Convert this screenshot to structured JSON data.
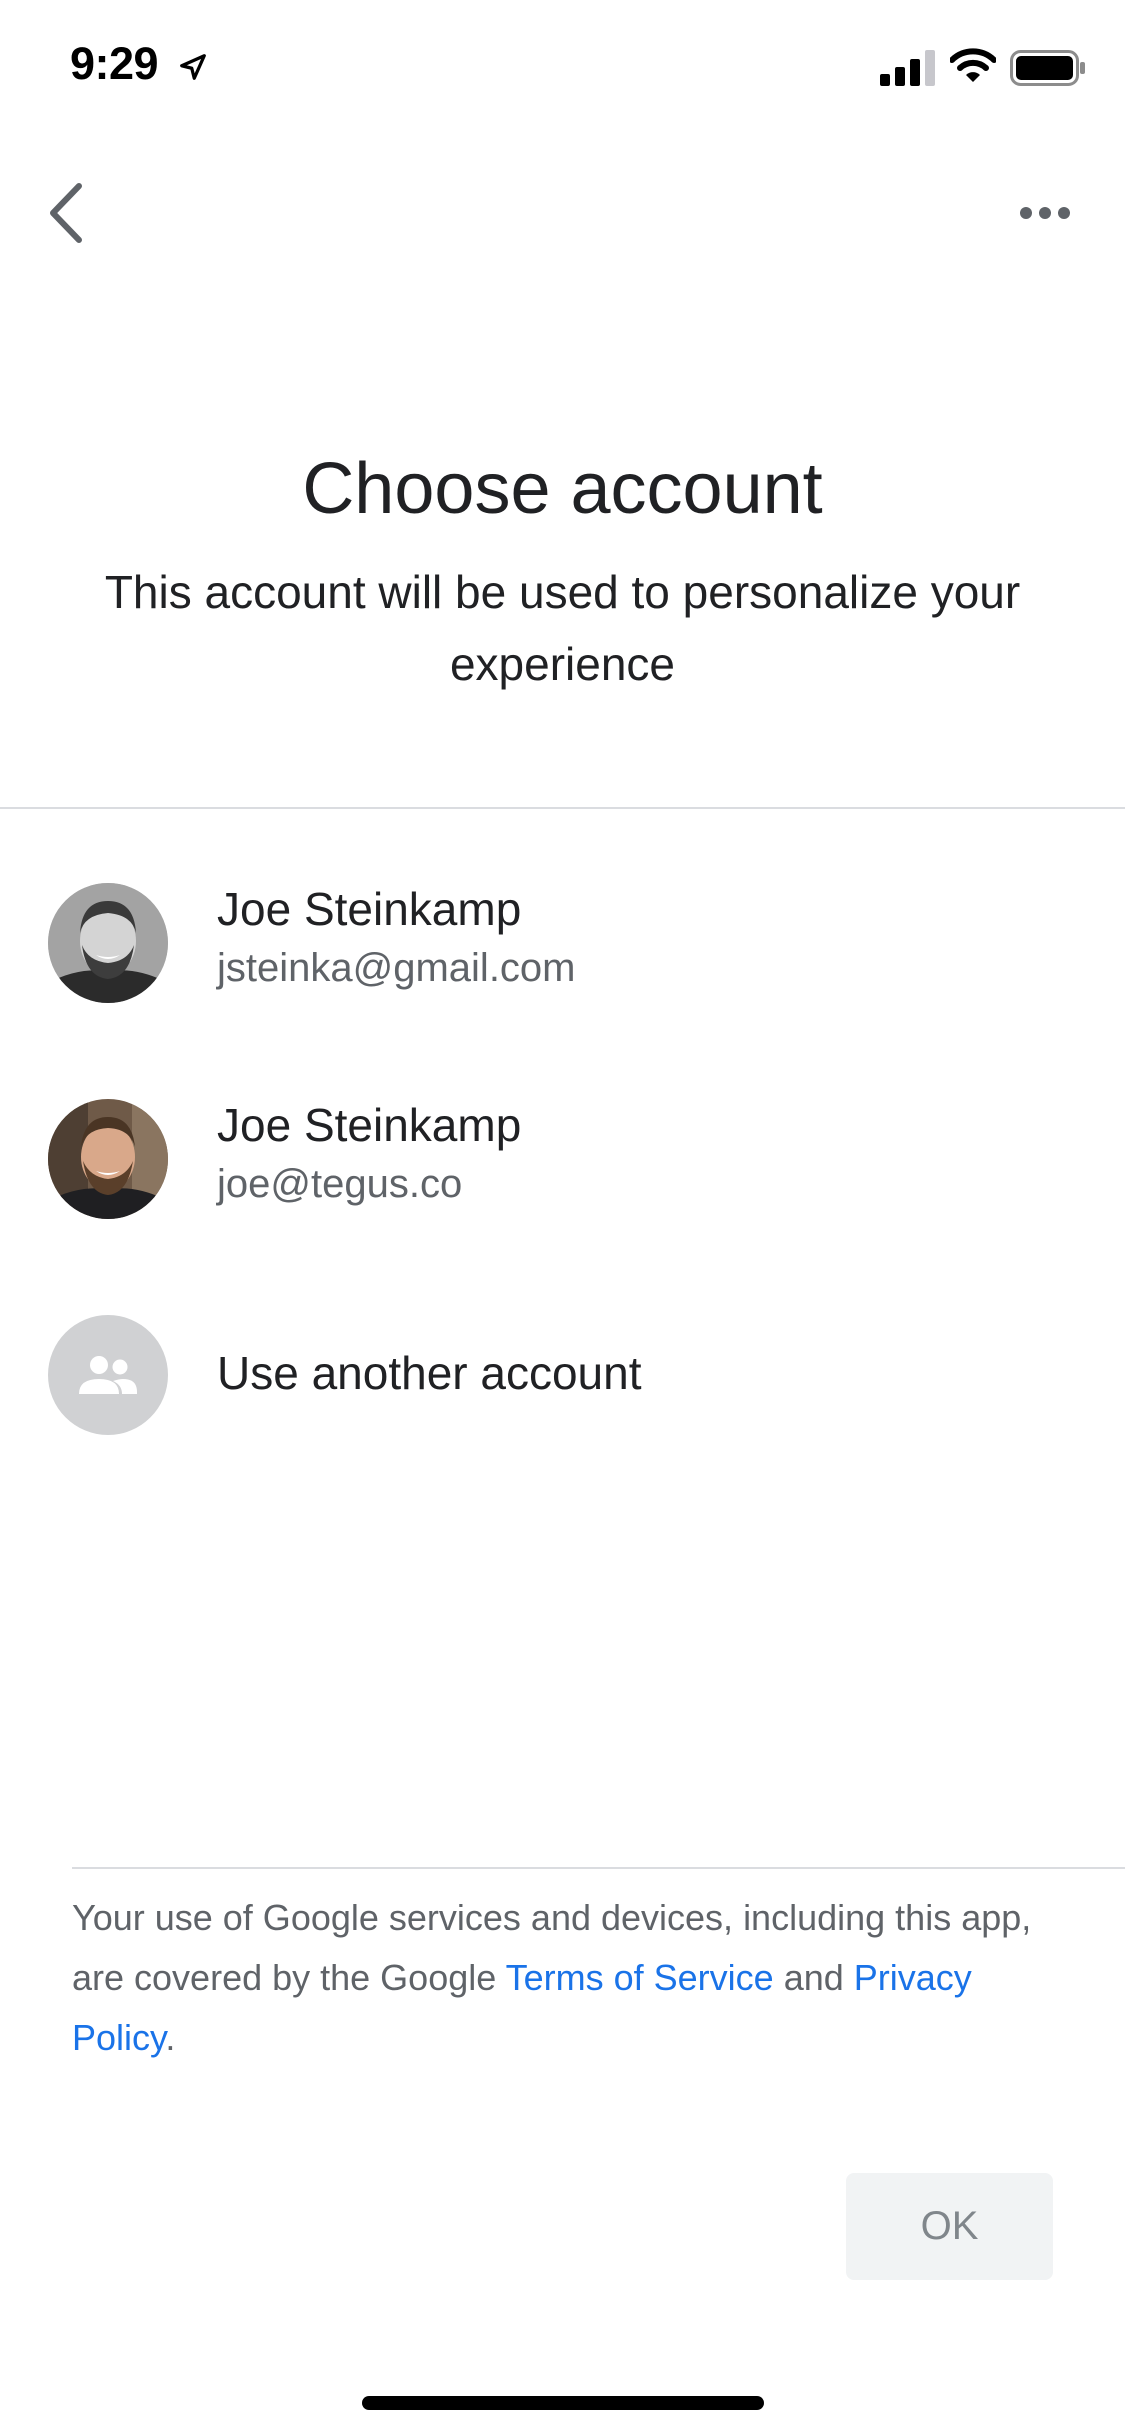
{
  "status_bar": {
    "time": "9:29",
    "icons": [
      "location-arrow-icon",
      "cellular-signal-icon",
      "wifi-icon",
      "battery-icon"
    ]
  },
  "nav": {
    "back_icon": "chevron-left-icon",
    "more_icon": "more-horizontal-icon"
  },
  "header": {
    "title": "Choose account",
    "subtitle": "This account will be used to personalize your experience"
  },
  "accounts": [
    {
      "name": "Joe Steinkamp",
      "email": "jsteinka@gmail.com"
    },
    {
      "name": "Joe Steinkamp",
      "email": "joe@tegus.co"
    }
  ],
  "other_account": {
    "label": "Use another account",
    "icon": "people-icon"
  },
  "footer": {
    "legal_prefix": "Your use of Google services and devices, including this app, are covered by the Google ",
    "terms_link": "Terms of Service",
    "legal_and": " and ",
    "privacy_link": "Privacy Policy",
    "legal_suffix": "."
  },
  "ok_button": {
    "label": "OK"
  },
  "colors": {
    "link": "#1a73e8",
    "divider": "#dadce0",
    "secondary_text": "#5f6368",
    "button_bg": "#f1f3f4",
    "avatar_placeholder": "#d0d1d3"
  }
}
